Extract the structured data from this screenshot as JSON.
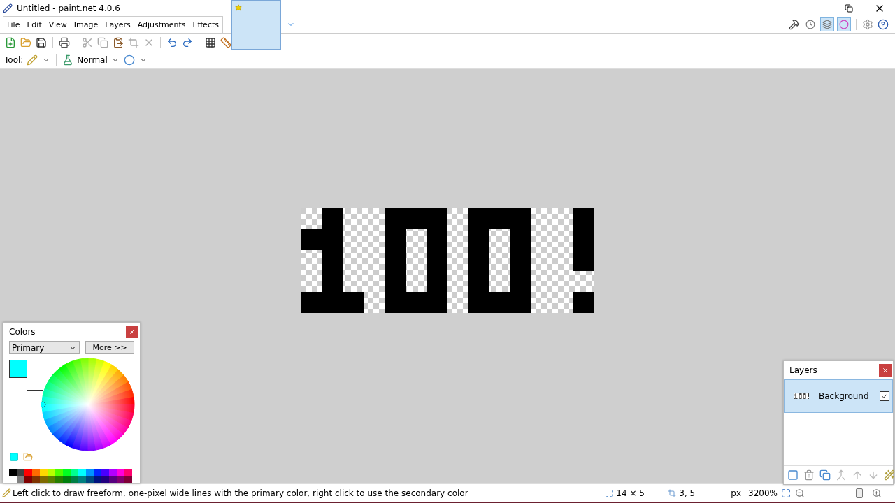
{
  "window": {
    "title": "Untitled - paint.net 4.0.6"
  },
  "menu": [
    "File",
    "Edit",
    "View",
    "Image",
    "Layers",
    "Adjustments",
    "Effects"
  ],
  "image_tabs": [
    {
      "selected": true
    }
  ],
  "view_toggles": [
    {
      "kind": "history",
      "selected": false
    },
    {
      "kind": "layers",
      "selected": true
    },
    {
      "kind": "colors",
      "selected": true
    }
  ],
  "tool_bar": {
    "label": "Tool:",
    "blend_mode": "Normal"
  },
  "colors_panel": {
    "title": "Colors",
    "mode": "Primary",
    "more_button": "More >>",
    "swatches": [
      {
        "kind": "secondary",
        "color": "#ffffff"
      },
      {
        "kind": "primary",
        "color": "#00ffff"
      }
    ],
    "palette_top": [
      {
        "color": "#000000"
      },
      {
        "color": "#404040"
      },
      {
        "color": "#ff0000"
      },
      {
        "color": "#ff6a00"
      },
      {
        "color": "#ffd800"
      },
      {
        "color": "#b6ff00"
      },
      {
        "color": "#4cff00"
      },
      {
        "color": "#00ff21"
      },
      {
        "color": "#00ff90"
      },
      {
        "color": "#00ffff"
      },
      {
        "color": "#0094ff"
      },
      {
        "color": "#0026ff"
      },
      {
        "color": "#4800ff"
      },
      {
        "color": "#b200ff"
      },
      {
        "color": "#ff00dc"
      },
      {
        "color": "#ff006e"
      }
    ],
    "palette_bottom": [
      {
        "color": "#808080"
      },
      {
        "color": "#7f0000"
      },
      {
        "color": "#7f3300"
      },
      {
        "color": "#7f6a00"
      },
      {
        "color": "#5b7f00"
      },
      {
        "color": "#267f00"
      },
      {
        "color": "#007f0e"
      },
      {
        "color": "#007f46"
      },
      {
        "color": "#007f7f"
      },
      {
        "color": "#004a7f"
      },
      {
        "color": "#00137f"
      },
      {
        "color": "#21007f"
      },
      {
        "color": "#57007f"
      },
      {
        "color": "#7f006e"
      },
      {
        "color": "#7f0037"
      }
    ]
  },
  "layers_panel": {
    "title": "Layers",
    "layers": [
      {
        "name": "Background",
        "visible": true,
        "selected": true
      }
    ]
  },
  "status_bar": {
    "hint": "Left click to draw freeform, one-pixel wide lines with the primary color, right click to use the secondary color",
    "size": "14 × 5",
    "position": "3, 5",
    "unit": "px",
    "zoom": "3200%",
    "zoom_level": {
      "level": 0.85
    }
  }
}
